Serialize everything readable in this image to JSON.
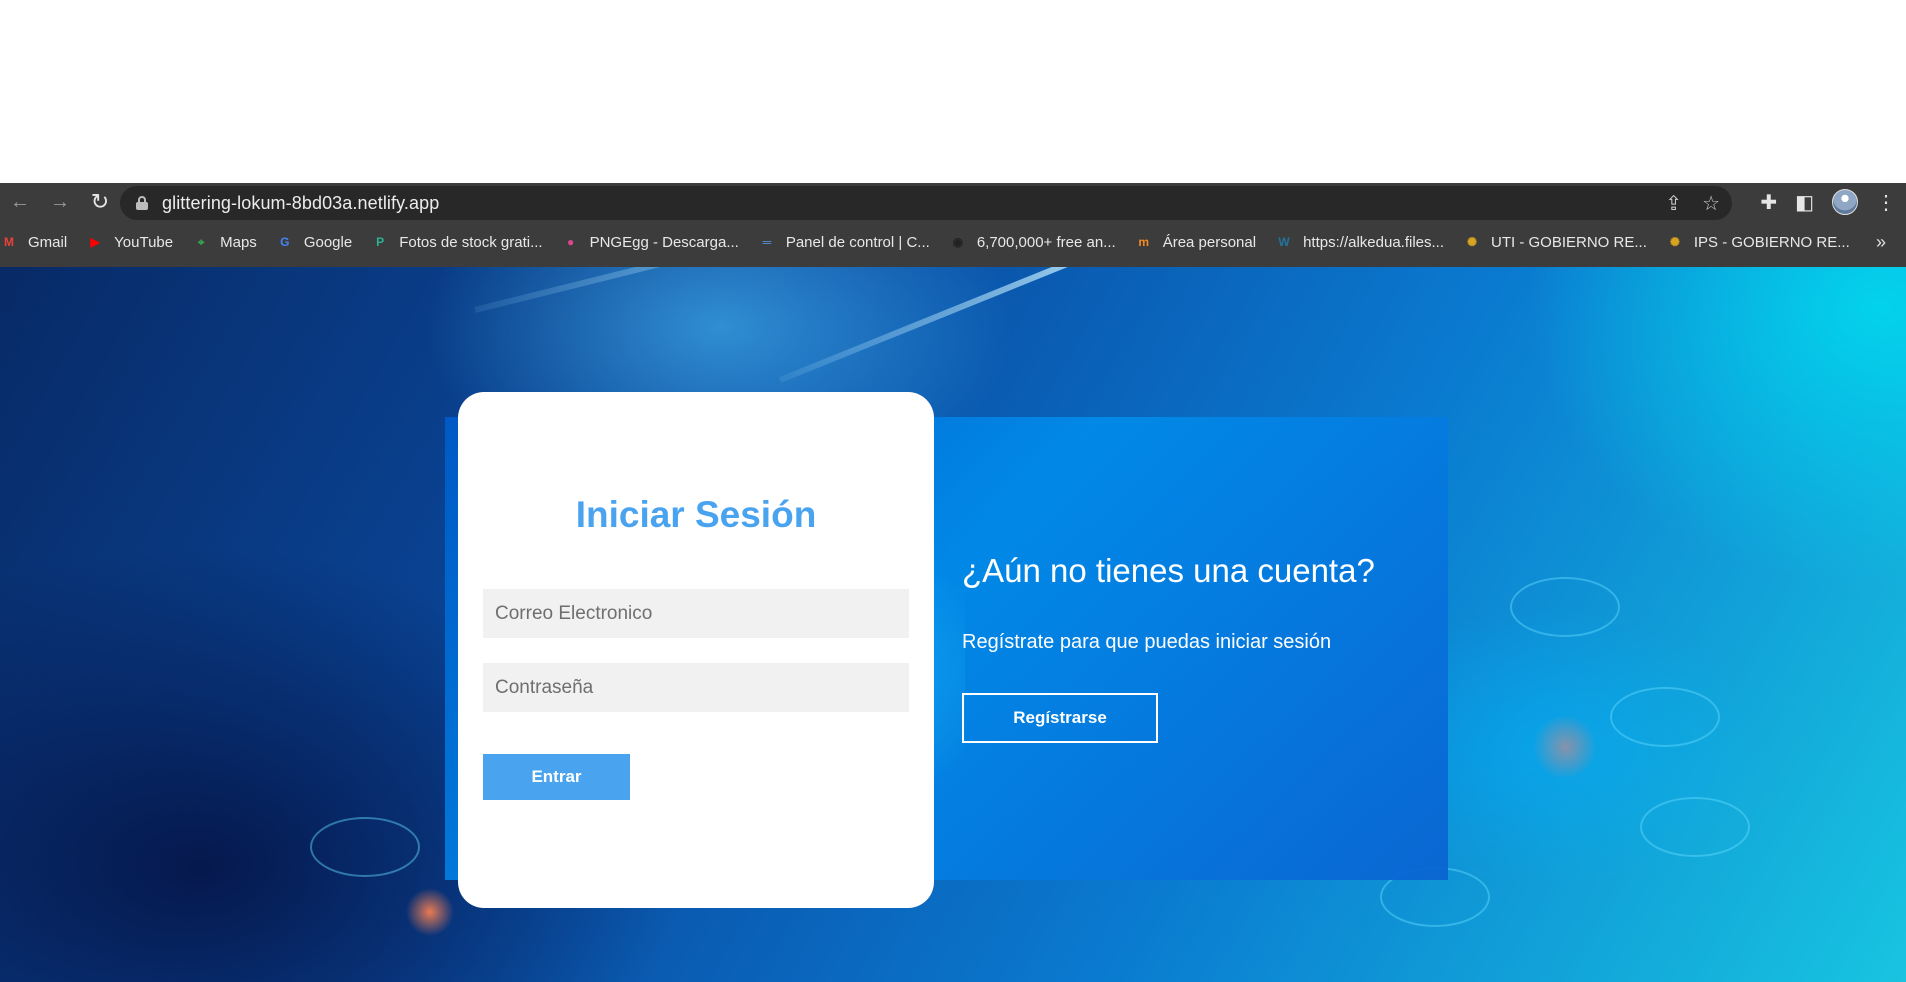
{
  "browser": {
    "url": "glittering-lokum-8bd03a.netlify.app",
    "nav": {
      "back": "←",
      "forward": "→",
      "reload": "↻"
    },
    "omnibox_icons": {
      "share": "⇪",
      "star": "☆"
    },
    "toolbar_icons": {
      "extensions": "✚",
      "side_panel": "◧",
      "menu": "⋮"
    },
    "bookmarks": [
      {
        "label": "Gmail",
        "icon": "gmail-icon",
        "glyph": "M",
        "color": "#ea4335"
      },
      {
        "label": "YouTube",
        "icon": "youtube-icon",
        "glyph": "▶",
        "color": "#ff0000"
      },
      {
        "label": "Maps",
        "icon": "maps-icon",
        "glyph": "⌖",
        "color": "#34a853"
      },
      {
        "label": "Google",
        "icon": "google-icon",
        "glyph": "G",
        "color": "#4285f4"
      },
      {
        "label": "Fotos de stock grati...",
        "icon": "stock-photos-icon",
        "glyph": "P",
        "color": "#2fb08f"
      },
      {
        "label": "PNGEgg - Descarga...",
        "icon": "pngegg-icon",
        "glyph": "●",
        "color": "#e0458e"
      },
      {
        "label": "Panel de control | C...",
        "icon": "control-panel-icon",
        "glyph": "═",
        "color": "#5a8fd6"
      },
      {
        "label": "6,700,000+ free an...",
        "icon": "free-assets-icon",
        "glyph": "◉",
        "color": "#222222"
      },
      {
        "label": "Área personal",
        "icon": "personal-area-icon",
        "glyph": "m",
        "color": "#f08a24"
      },
      {
        "label": "https://alkedua.files...",
        "icon": "wordpress-icon",
        "glyph": "W",
        "color": "#21759b"
      },
      {
        "label": "UTI - GOBIERNO RE...",
        "icon": "gov-seal-icon",
        "glyph": "✺",
        "color": "#d9a520"
      },
      {
        "label": "IPS - GOBIERNO RE...",
        "icon": "gov-seal-icon",
        "glyph": "✺",
        "color": "#d9a520"
      }
    ],
    "bookmarks_more": "»"
  },
  "login": {
    "title": "Iniciar Sesión",
    "email_placeholder": "Correo Electronico",
    "password_placeholder": "Contraseña",
    "submit_label": "Entrar"
  },
  "register": {
    "title": "¿Aún no tienes una cuenta?",
    "text": "Regístrate para que puedas iniciar sesión",
    "button_label": "Regístrarse"
  },
  "colors": {
    "accent": "#4aa3ef",
    "panel_blue": "#0a6fd6",
    "browser_chrome": "#3c3c3c"
  }
}
